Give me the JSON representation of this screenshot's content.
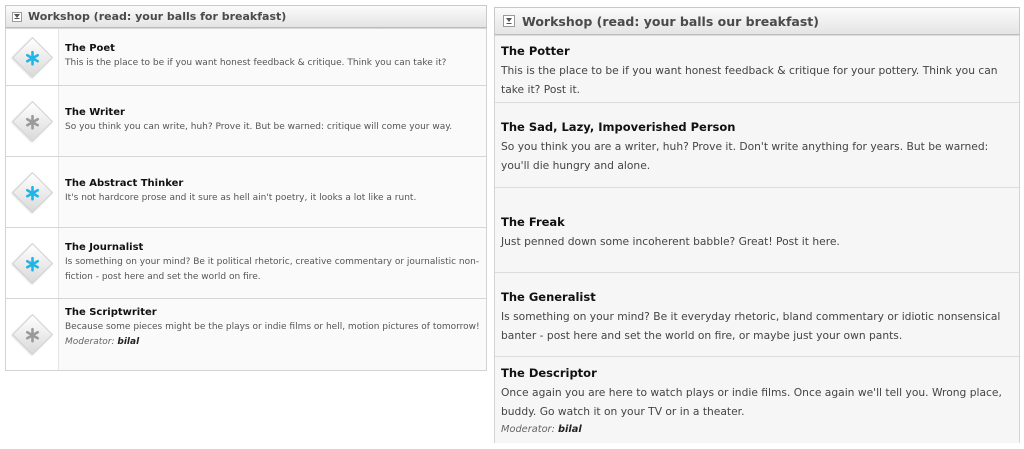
{
  "left": {
    "header": "Workshop (read: your balls for breakfast)",
    "rows": [
      {
        "title": "The Poet",
        "desc": "This is the place to be if you want honest feedback & critique. Think you can take it?",
        "icon": "cyan-asterisk-icon",
        "icon_color": "#1fb5e6"
      },
      {
        "title": "The Writer",
        "desc": "So you think you can write, huh? Prove it. But be warned: critique will come your way.",
        "icon": "gray-asterisk-icon",
        "icon_color": "#9a9a9a"
      },
      {
        "title": "The Abstract Thinker",
        "desc": "It's not hardcore prose and it sure as hell ain't poetry, it looks a lot like a runt.",
        "icon": "cyan-asterisk-icon",
        "icon_color": "#1fb5e6"
      },
      {
        "title": "The Journalist",
        "desc": "Is something on your mind? Be it political rhetoric, creative commentary or journalistic non-fiction - post here and set the world on fire.",
        "icon": "cyan-asterisk-icon",
        "icon_color": "#1fb5e6"
      },
      {
        "title": "The Scriptwriter",
        "desc": "Because some pieces might be the plays or indie films or hell, motion pictures of tomorrow!",
        "icon": "gray-asterisk-icon",
        "icon_color": "#9a9a9a",
        "moderator_label": "Moderator:",
        "moderator": "bilal"
      }
    ]
  },
  "right": {
    "header": "Workshop (read: your balls our breakfast)",
    "rows": [
      {
        "title": "The Potter",
        "desc": "This is the place to be if you want honest feedback & critique for your pottery. Think you can take it? Post it."
      },
      {
        "title": "The Sad, Lazy, Impoverished Person",
        "desc": "So you think you are a writer, huh? Prove it. Don't write anything for years. But be warned: you'll die hungry and alone."
      },
      {
        "title": "The Freak",
        "desc": "Just penned down some incoherent babble? Great! Post it here."
      },
      {
        "title": "The Generalist",
        "desc": "Is something on your mind? Be it everyday rhetoric, bland commentary or idiotic nonsensical banter - post here and set the world on fire, or maybe just your own pants."
      },
      {
        "title": "The Descriptor",
        "desc": "Once again you are here to watch plays or indie films. Once again we'll tell you. Wrong place, buddy. Go watch it on your TV or in a theater.",
        "moderator_label": "Moderator:",
        "moderator": "bilal"
      }
    ]
  }
}
